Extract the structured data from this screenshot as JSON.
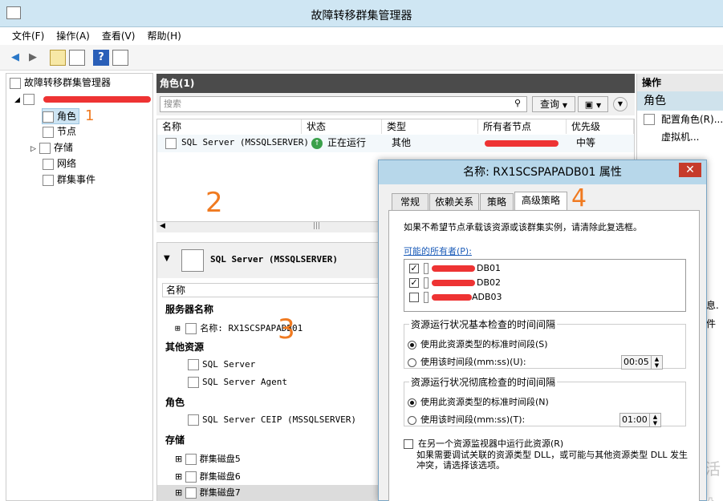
{
  "window": {
    "title": "故障转移群集管理器"
  },
  "menu": [
    "文件(F)",
    "操作(A)",
    "查看(V)",
    "帮助(H)"
  ],
  "tree": {
    "root": "故障转移群集管理器",
    "items": [
      "角色",
      "节点",
      "存储",
      "网络",
      "群集事件"
    ]
  },
  "roles_panel": {
    "title": "角色(1)",
    "search_placeholder": "搜索",
    "query_label": "查询",
    "columns": [
      "名称",
      "状态",
      "类型",
      "所有者节点",
      "优先级"
    ],
    "row": {
      "name": "SQL Server (MSSQLSERVER)",
      "status": "正在运行",
      "type": "其他",
      "priority": "中等"
    }
  },
  "detail": {
    "title": "SQL Server (MSSQLSERVER)",
    "column_header": "名称",
    "server_section": "服务器名称",
    "server_item": "名称: RX1SCSPAPADB01",
    "other_section": "其他资源",
    "other_items": [
      "SQL Server",
      "SQL Server Agent"
    ],
    "role_section": "角色",
    "role_item": "SQL Server CEIP (MSSQLSERVER)",
    "storage_section": "存储",
    "storage_items": [
      "群集磁盘5",
      "群集磁盘6",
      "群集磁盘7"
    ]
  },
  "actions": {
    "header": "操作",
    "sub": "角色",
    "items": [
      "配置角色(R)...",
      "虚拟机..."
    ],
    "partial": [
      "息.",
      "件"
    ]
  },
  "dialog": {
    "title": "名称: RX1SCSPAPADB01 属性",
    "tabs": [
      "常规",
      "依赖关系",
      "策略",
      "高级策略"
    ],
    "intro": "如果不希望节点承载该资源或该群集实例，请清除此复选框。",
    "owners_label": "可能的所有者(P):",
    "owners": [
      {
        "suffix": "DB01",
        "checked": true
      },
      {
        "suffix": "DB02",
        "checked": true
      },
      {
        "suffix": "ADB03",
        "checked": false
      }
    ],
    "basic_group": "资源运行状况基本检查的时间间隔",
    "basic_opt1": "使用此资源类型的标准时间段(S)",
    "basic_opt2": "使用该时间段(mm:ss)(U):",
    "basic_value": "00:05",
    "thorough_group": "资源运行状况彻底检查的时间间隔",
    "thorough_opt1": "使用此资源类型的标准时间段(N)",
    "thorough_opt2": "使用该时间段(mm:ss)(T):",
    "thorough_value": "01:00",
    "separate_label": "在另一个资源监视器中运行此资源(R)",
    "separate_desc": "如果需要调试关联的资源类型 DLL，或可能与其他资源类型 DLL 发生冲突，请选择该选项。"
  },
  "annotations": [
    "1",
    "2",
    "3",
    "4"
  ],
  "watermark": [
    "激活",
    "转到\"设"
  ]
}
